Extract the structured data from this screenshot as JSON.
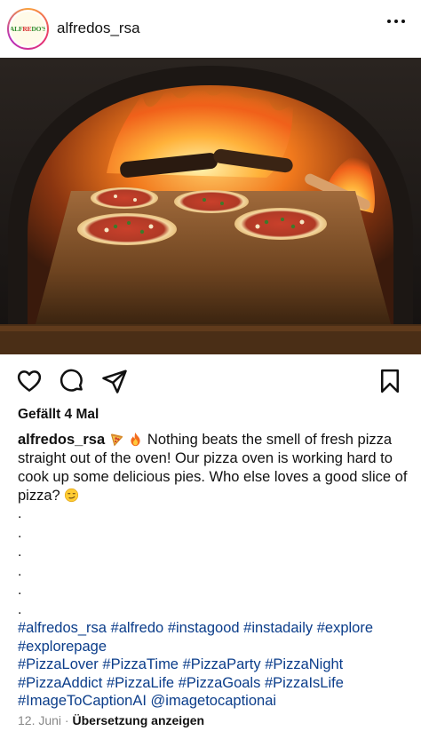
{
  "header": {
    "username": "alfredos_rsa",
    "avatar_text_a": "ALF",
    "avatar_text_b": "RE",
    "avatar_text_c": "DO'S"
  },
  "photo": {
    "subject": "pizza-oven-photo"
  },
  "actions": {
    "like_icon": "heart-icon",
    "comment_icon": "comment-icon",
    "share_icon": "send-icon",
    "save_icon": "bookmark-icon"
  },
  "likes_text": "Gefällt 4 Mal",
  "caption": {
    "username": "alfredos_rsa",
    "text": " Nothing beats the smell of fresh pizza straight out of the oven! Our pizza oven is working hard to cook up some delicious pies. Who else loves a good slice of pizza? "
  },
  "dots": [
    ".",
    ".",
    ".",
    ".",
    ".",
    "."
  ],
  "hashtag_lines": [
    [
      "#alfredos_rsa",
      "#alfredo",
      "#instagood",
      "#instadaily",
      "#explore"
    ],
    [
      "#explorepage"
    ],
    [
      "#PizzaLover",
      "#PizzaTime",
      "#PizzaParty",
      "#PizzaNight"
    ],
    [
      "#PizzaAddict",
      "#PizzaLife",
      "#PizzaGoals",
      " #PizzaIsLife"
    ],
    [
      "#ImageToCaptionAI",
      "@imagetocaptionai"
    ]
  ],
  "footer": {
    "date": "12. Juni",
    "separator": " · ",
    "translate": "Übersetzung anzeigen"
  },
  "colors": {
    "link": "#0b3d8a",
    "muted": "#888888",
    "text": "#111111"
  }
}
